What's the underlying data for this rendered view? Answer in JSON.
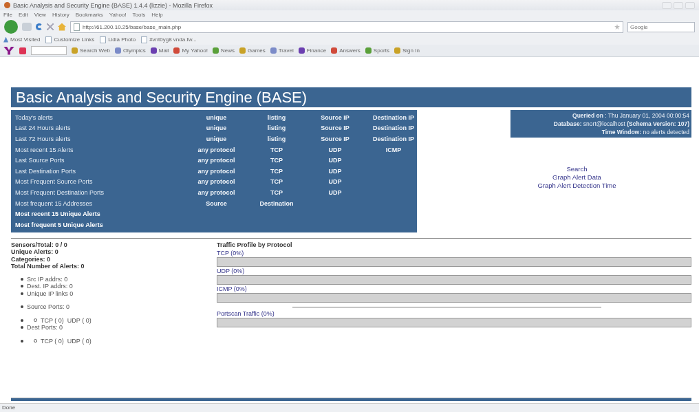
{
  "window": {
    "title": "Basic Analysis and Security Engine (BASE) 1.4.4 (lizzie) - Mozilla Firefox"
  },
  "menu_bar": [
    "File",
    "Edit",
    "View",
    "History",
    "Bookmarks",
    "Yahoo!",
    "Tools",
    "Help"
  ],
  "address_bar": {
    "value": "http://61.200.10.25/base/base_main.php"
  },
  "search_field": {
    "placeholder": "Google"
  },
  "bookmarks": [
    {
      "label": "Most Visited",
      "kind": "star"
    },
    {
      "label": "Customize Links",
      "kind": "page"
    },
    {
      "label": "Lidia Photo",
      "kind": "page"
    },
    {
      "label": "#vnt0yg8 vnda.fw...",
      "kind": "page"
    }
  ],
  "yahoo_toolbar": [
    "Search Web",
    "Olympics",
    "Mail",
    "My Yahoo!",
    "News",
    "Games",
    "Travel",
    "Finance",
    "Answers",
    "Sports",
    "Sign In"
  ],
  "page_title": "Basic Analysis and Security Engine (BASE)",
  "nav_rows": [
    {
      "label": "Today's alerts",
      "bold": false,
      "links": [
        "unique",
        "listing",
        "Source IP",
        "Destination IP"
      ]
    },
    {
      "label": "Last 24 Hours alerts",
      "bold": false,
      "links": [
        "unique",
        "listing",
        "Source IP",
        "Destination IP"
      ]
    },
    {
      "label": "Last 72 Hours alerts",
      "bold": false,
      "links": [
        "unique",
        "listing",
        "Source IP",
        "Destination IP"
      ]
    },
    {
      "label": "Most recent 15 Alerts",
      "bold": false,
      "links": [
        "any protocol",
        "TCP",
        "UDP",
        "ICMP"
      ]
    },
    {
      "label": "Last Source Ports",
      "bold": false,
      "links": [
        "any protocol",
        "TCP",
        "UDP"
      ]
    },
    {
      "label": "Last Destination Ports",
      "bold": false,
      "links": [
        "any protocol",
        "TCP",
        "UDP"
      ]
    },
    {
      "label": "Most Frequent Source Ports",
      "bold": false,
      "links": [
        "any protocol",
        "TCP",
        "UDP"
      ]
    },
    {
      "label": "Most Frequent Destination Ports",
      "bold": false,
      "links": [
        "any protocol",
        "TCP",
        "UDP"
      ]
    },
    {
      "label": "Most frequent 15 Addresses",
      "bold": false,
      "links": [
        "Source",
        "Destination"
      ]
    },
    {
      "label": "Most recent 15 Unique Alerts",
      "bold": true,
      "links": []
    },
    {
      "label": "Most frequent 5 Unique Alerts",
      "bold": true,
      "links": []
    }
  ],
  "info_box": [
    "**Queried on** : Thu January 01, 2004 00:00:54",
    "**Database:** snort@localhost   **(Schema Version: 107)**",
    "**Time Window:** no alerts detected"
  ],
  "actions": [
    "Search",
    "Graph Alert Data",
    "Graph Alert Detection Time"
  ],
  "stats": [
    "Sensors/Total: 0 / 0",
    "Unique Alerts: 0",
    "Categories: 0",
    "Total Number of Alerts: 0"
  ],
  "stat_items": [
    {
      "text": "Src IP addrs: 0",
      "kind": "bullet"
    },
    {
      "text": "Dest. IP addrs: 0",
      "kind": "bullet"
    },
    {
      "text": "Unique IP links 0",
      "kind": "bullet"
    },
    {
      "text": "Source Ports: 0",
      "kind": "bullet-gap"
    },
    {
      "text": "TCP ( 0)  UDP ( 0)",
      "kind": "sub"
    },
    {
      "text": "Dest Ports: 0",
      "kind": "bullet"
    },
    {
      "text": "TCP ( 0)  UDP ( 0)",
      "kind": "sub-gap"
    }
  ],
  "traffic": {
    "title": "Traffic Profile by Protocol",
    "bars": [
      {
        "label": "TCP (0%)",
        "level": 0,
        "kind": "protocol"
      },
      {
        "label": "UDP (0%)",
        "level": 0,
        "kind": "protocol"
      },
      {
        "label": "ICMP (0%)",
        "level": 0,
        "kind": "protocol"
      },
      {
        "label": "Portscan Traffic (0%)",
        "level": 0,
        "kind": "portscan"
      }
    ]
  },
  "status_bar": "Done"
}
